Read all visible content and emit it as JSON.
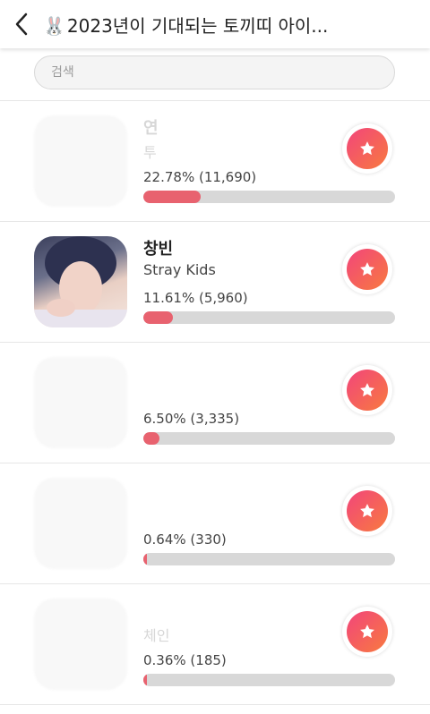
{
  "header": {
    "back_icon": "chevron-left-icon",
    "emoji": "🐰",
    "title": "2023년이 기대되는 토끼띠 아이..."
  },
  "search": {
    "placeholder": "검색",
    "value": ""
  },
  "colors": {
    "accent_gradient_start": "#f2457b",
    "accent_gradient_end": "#f87a3f",
    "bar_fill": "#e8626f",
    "bar_track": "#d8d8d8"
  },
  "items": [
    {
      "name": "연",
      "group": "투",
      "percent_text": "22.78% (11,690)",
      "fraction": 0.2278,
      "favorite_icon": "star-icon"
    },
    {
      "name": "창빈",
      "group": "Stray Kids",
      "percent_text": "11.61% (5,960)",
      "fraction": 0.1161,
      "favorite_icon": "star-icon"
    },
    {
      "name": "",
      "group": "",
      "percent_text": "6.50% (3,335)",
      "fraction": 0.065,
      "favorite_icon": "star-icon"
    },
    {
      "name": "",
      "group": "",
      "percent_text": "0.64% (330)",
      "fraction": 0.0064,
      "favorite_icon": "star-icon"
    },
    {
      "name": "",
      "group": "체인",
      "percent_text": "0.36% (185)",
      "fraction": 0.0036,
      "favorite_icon": "star-icon"
    }
  ]
}
